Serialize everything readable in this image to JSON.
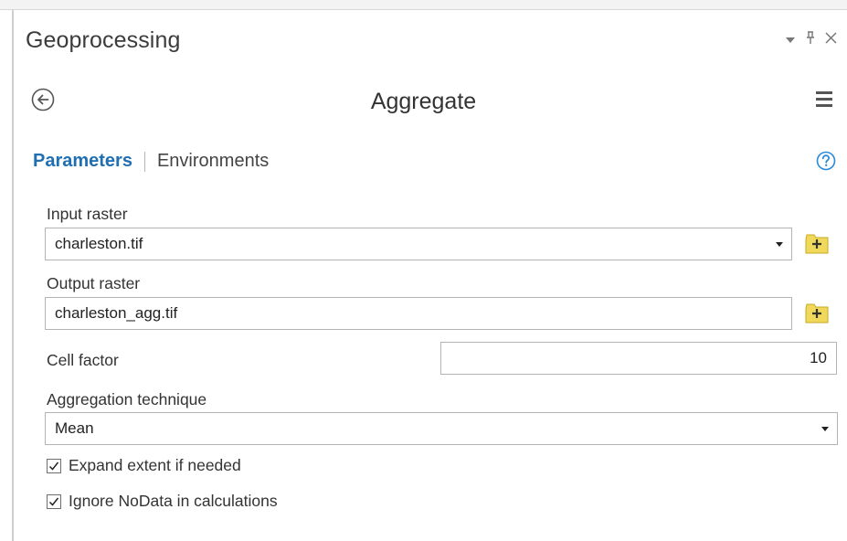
{
  "pane": {
    "title": "Geoprocessing",
    "controls": {
      "dropdown": "▾",
      "pin": "⨪",
      "close": "✕"
    }
  },
  "tool": {
    "title": "Aggregate"
  },
  "tabs": {
    "parameters": "Parameters",
    "environments": "Environments"
  },
  "params": {
    "input_raster": {
      "label": "Input raster",
      "value": "charleston.tif"
    },
    "output_raster": {
      "label": "Output raster",
      "value": "charleston_agg.tif"
    },
    "cell_factor": {
      "label": "Cell factor",
      "value": "10"
    },
    "aggregation_technique": {
      "label": "Aggregation technique",
      "value": "Mean"
    },
    "expand_extent": {
      "label": "Expand extent if needed",
      "checked": true
    },
    "ignore_nodata": {
      "label": "Ignore NoData in calculations",
      "checked": true
    }
  },
  "colors": {
    "accent": "#1f6fb2",
    "browse_icon": "#f0d85a",
    "help_icon": "#2b8ad6"
  }
}
